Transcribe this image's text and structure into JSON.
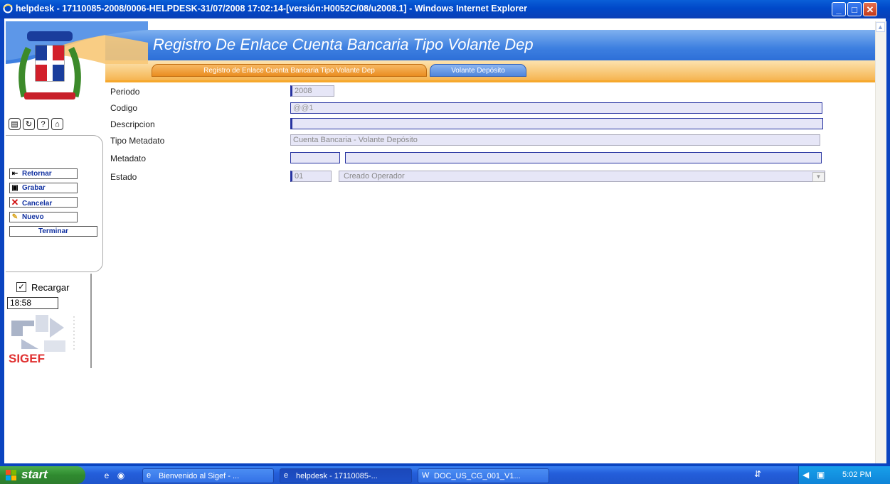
{
  "window": {
    "title": "helpdesk - 17110085-2008/0006-HELPDESK-31/07/2008 17:02:14-[versión:H0052C/08/u2008.1] - Windows Internet Explorer",
    "minimize": "_",
    "maximize": "□",
    "close": "✕"
  },
  "header": {
    "title": "Registro De Enlace Cuenta Bancaria Tipo Volante Dep",
    "tabs": [
      {
        "label": "Registro de Enlace Cuenta Bancaria Tipo Volante Dep"
      },
      {
        "label": "Volante Depósito"
      }
    ]
  },
  "sidebar": {
    "tool_icons": [
      "document-icon",
      "refresh-icon",
      "help-icon",
      "home-icon"
    ],
    "buttons": [
      {
        "label": "Retornar",
        "icon": "back-arrow-icon"
      },
      {
        "label": "Grabar",
        "icon": "save-icon"
      },
      {
        "label": "Cancelar",
        "icon": "cancel-icon"
      },
      {
        "label": "Nuevo",
        "icon": "pencil-icon"
      },
      {
        "label": "Terminar",
        "icon": ""
      }
    ],
    "reload_label": "Recargar",
    "reload_checked": true,
    "clock": "18:58",
    "logo_text": "SIGEF"
  },
  "form": {
    "periodo_label": "Periodo",
    "periodo_value": "2008",
    "codigo_label": "Codigo",
    "codigo_value": "@@1",
    "descripcion_label": "Descripcion",
    "descripcion_value": "",
    "tipo_metadato_label": "Tipo Metadato",
    "tipo_metadato_value": "Cuenta Bancaria - Volante Depósito",
    "metadato_label": "Metadato",
    "metadato_code": "",
    "metadato_desc": "",
    "estado_label": "Estado",
    "estado_code": "01",
    "estado_value": "Creado Operador"
  },
  "taskbar": {
    "start_label": "start",
    "items": [
      {
        "label": "Bienvenido al Sigef - ..."
      },
      {
        "label": "helpdesk - 17110085-..."
      },
      {
        "label": "DOC_US_CG_001_V1..."
      }
    ],
    "time": "5:02 PM"
  }
}
